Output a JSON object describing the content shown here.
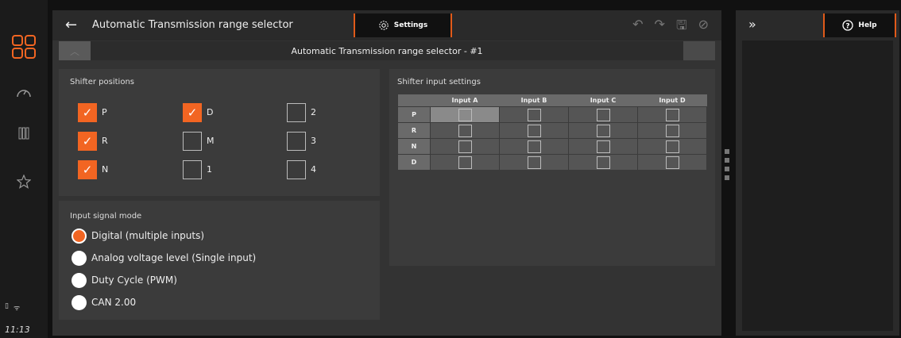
{
  "sidebar": {
    "time": "11:13",
    "icons": [
      "apps-grid-icon",
      "gauge-icon",
      "columns-icon",
      "star-icon"
    ],
    "status": [
      "battery-icon",
      "wifi-icon"
    ]
  },
  "header": {
    "title": "Automatic Transmission range selector",
    "settings_label": "Settings",
    "toolbar_icons": [
      "undo-icon",
      "redo-icon",
      "save-icon",
      "disabled-icon"
    ]
  },
  "selector": {
    "value": "Automatic Transmission range selector - #1"
  },
  "shifter_positions": {
    "title": "Shifter positions",
    "items": [
      {
        "label": "P",
        "checked": true
      },
      {
        "label": "D",
        "checked": true
      },
      {
        "label": "2",
        "checked": false
      },
      {
        "label": "R",
        "checked": true
      },
      {
        "label": "M",
        "checked": false
      },
      {
        "label": "3",
        "checked": false
      },
      {
        "label": "N",
        "checked": true
      },
      {
        "label": "1",
        "checked": false
      },
      {
        "label": "4",
        "checked": false
      }
    ]
  },
  "input_signal_mode": {
    "title": "Input signal mode",
    "options": [
      {
        "label": "Digital (multiple inputs)",
        "selected": true
      },
      {
        "label": "Analog voltage level (Single input)",
        "selected": false
      },
      {
        "label": "Duty Cycle (PWM)",
        "selected": false
      },
      {
        "label": "CAN 2.00",
        "selected": false
      }
    ]
  },
  "shifter_input_settings": {
    "title": "Shifter input settings",
    "columns": [
      "Input A",
      "Input B",
      "Input C",
      "Input D"
    ],
    "rows": [
      "P",
      "R",
      "N",
      "D"
    ]
  },
  "help": {
    "label": "Help"
  },
  "colors": {
    "accent": "#f26522"
  }
}
